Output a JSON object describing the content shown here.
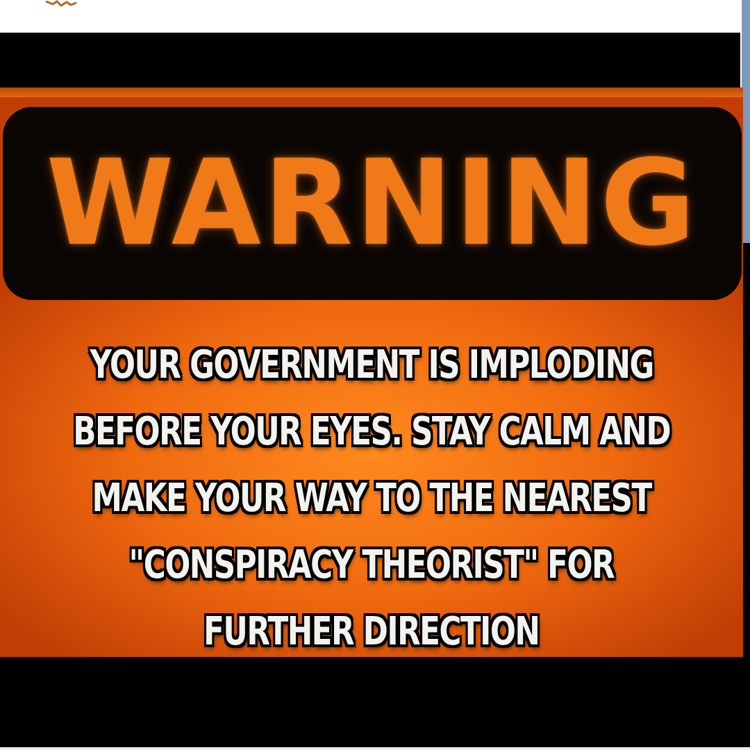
{
  "sign": {
    "title": "WARNING",
    "message_lines": [
      "YOUR GOVERNMENT IS IMPLODING",
      "BEFORE YOUR EYES.  STAY CALM AND",
      "MAKE YOUR WAY TO THE NEAREST",
      "\"CONSPIRACY THEORIST\" FOR",
      "FURTHER DIRECTION"
    ],
    "colors": {
      "background_orange": "#f06a10",
      "panel_black": "#0a0604",
      "title_orange": "#f07a18",
      "message_white": "#f2f2ee"
    }
  }
}
